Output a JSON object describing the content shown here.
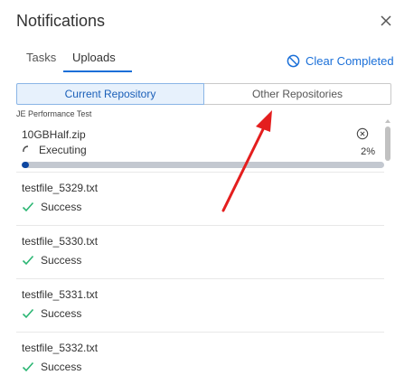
{
  "header": {
    "title": "Notifications",
    "close_icon": "close-icon"
  },
  "tabs": [
    {
      "label": "Tasks",
      "active": false
    },
    {
      "label": "Uploads",
      "active": true
    }
  ],
  "clear_completed": {
    "label": "Clear Completed",
    "icon": "block-icon"
  },
  "repository_toggle": {
    "options": [
      "Current Repository",
      "Other Repositories"
    ],
    "selected": "Current Repository"
  },
  "group_label": "JE Performance Test",
  "uploads": [
    {
      "file": "10GBHalf.zip",
      "status": "Executing",
      "percent_label": "2%",
      "progress": 0.02
    },
    {
      "file": "testfile_5329.txt",
      "status": "Success"
    },
    {
      "file": "testfile_5330.txt",
      "status": "Success"
    },
    {
      "file": "testfile_5331.txt",
      "status": "Success"
    },
    {
      "file": "testfile_5332.txt",
      "status": "Success"
    }
  ],
  "colors": {
    "accent": "#1a6fd8",
    "progress_fill": "#0d47a1",
    "success_check": "#2bb673",
    "annotation_arrow": "#e41e1e"
  }
}
